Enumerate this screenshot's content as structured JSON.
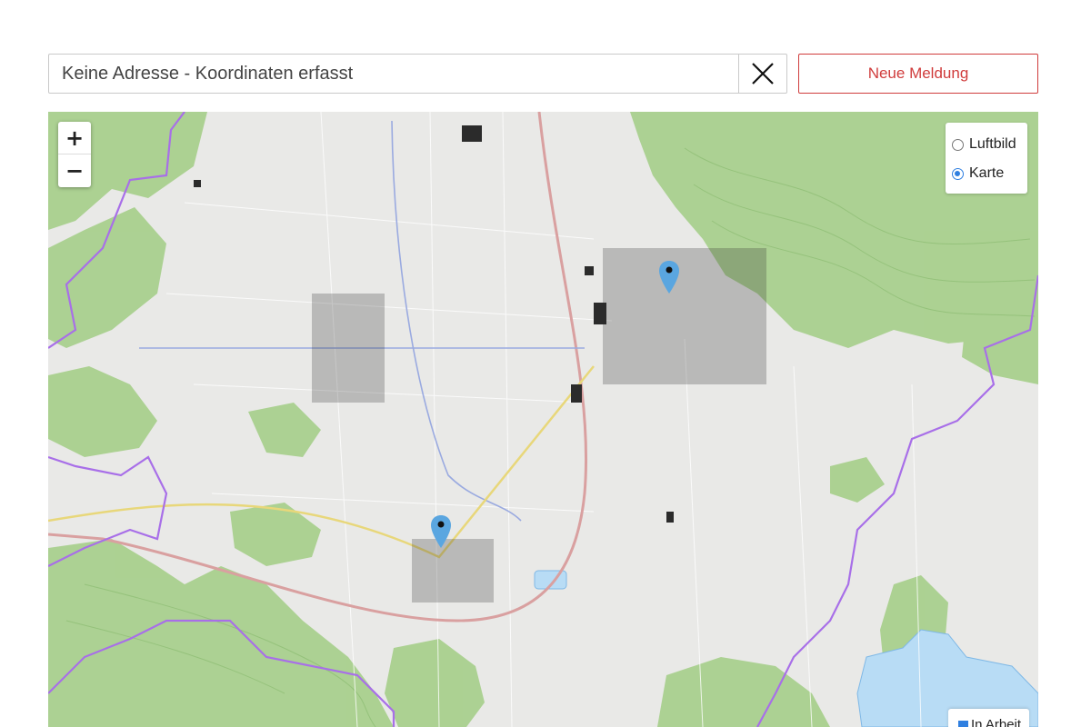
{
  "search": {
    "value": "Keine Adresse - Koordinaten erfasst"
  },
  "actions": {
    "new_report_label": "Neue Meldung"
  },
  "map": {
    "zoom_in_label": "+",
    "zoom_out_label": "−",
    "layers": [
      {
        "label": "Luftbild",
        "selected": false
      },
      {
        "label": "Karte",
        "selected": true
      }
    ],
    "marker_color": "#5aa6e0",
    "legend": {
      "label": "In Arbeit",
      "color": "#2f7fe0"
    }
  },
  "colors": {
    "accent": "#d03c3c",
    "forest": "#a9d08e",
    "border": "#a86fe8"
  }
}
